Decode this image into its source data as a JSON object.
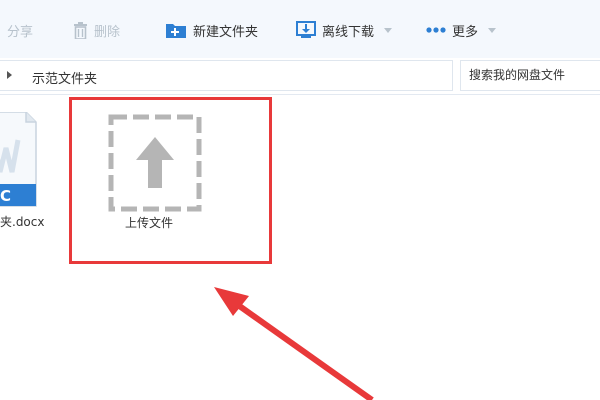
{
  "toolbar": {
    "share_label": "分享",
    "delete_label": "删除",
    "new_folder_label": "新建文件夹",
    "offline_download_label": "离线下载",
    "more_label": "更多"
  },
  "address_bar": {
    "path": "示范文件夹",
    "search_placeholder": "搜索我的网盘文件"
  },
  "files": [
    {
      "name": "夹.docx",
      "icon": "word-doc-icon",
      "badge": "C"
    },
    {
      "name": "上传文件",
      "icon": "upload-icon"
    }
  ],
  "colors": {
    "toolbar_bg": "#f4f8fd",
    "accent_blue": "#2d7fd3",
    "disabled_text": "#b7c2cc",
    "highlight_red": "#e8393a"
  }
}
